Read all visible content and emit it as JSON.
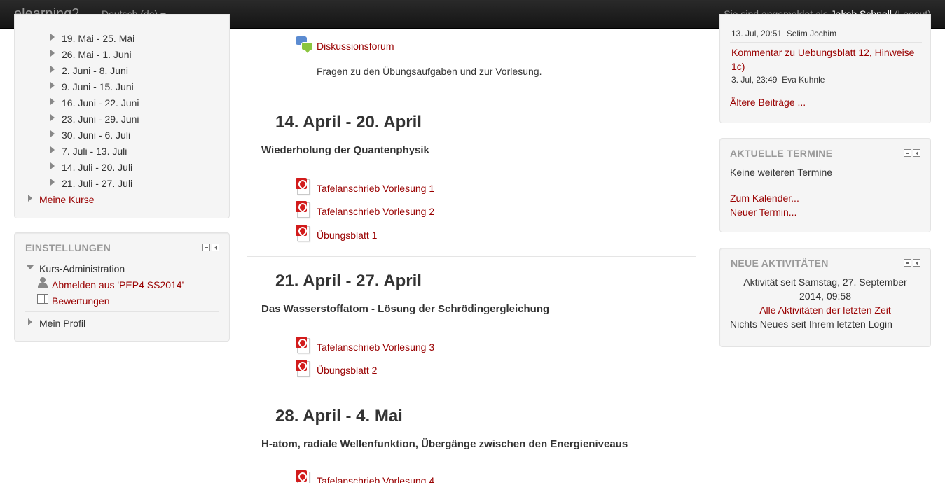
{
  "navbar": {
    "brand": "elearning2",
    "language": "Deutsch (de)",
    "login_prefix": "Sie sind angemeldet als ",
    "user_name": "Jakob Schnell",
    "logout": "(Logout)"
  },
  "navigation": {
    "weeks": [
      "19. Mai - 25. Mai",
      "26. Mai - 1. Juni",
      "2. Juni - 8. Juni",
      "9. Juni - 15. Juni",
      "16. Juni - 22. Juni",
      "23. Juni - 29. Juni",
      "30. Juni - 6. Juli",
      "7. Juli - 13. Juli",
      "14. Juli - 20. Juli",
      "21. Juli - 27. Juli"
    ],
    "my_courses": "Meine Kurse"
  },
  "settings": {
    "title": "EINSTELLUNGEN",
    "course_admin": "Kurs-Administration",
    "unenrol": "Abmelden aus 'PEP4 SS2014'",
    "grades": "Bewertungen",
    "my_profile": "Mein Profil"
  },
  "main": {
    "forum": {
      "label": "Diskussionsforum",
      "description": "Fragen zu den Übungsaufgaben und zur Vorlesung."
    },
    "sections": [
      {
        "title": "14. April - 20. April",
        "summary": "Wiederholung der Quantenphysik",
        "activities": [
          "Tafelanschrieb Vorlesung 1",
          "Tafelanschrieb Vorlesung 2",
          "Übungsblatt 1"
        ]
      },
      {
        "title": "21. April - 27. April",
        "summary": "Das Wasserstoffatom - Lösung der Schrödingergleichung",
        "activities": [
          "Tafelanschrieb Vorlesung 3",
          "Übungsblatt 2"
        ]
      },
      {
        "title": "28. April - 4. Mai",
        "summary": "H-atom, radiale Wellenfunktion, Übergänge zwischen den Energieniveaus",
        "activities": [
          "Tafelanschrieb Vorlesung 4"
        ]
      }
    ]
  },
  "news": {
    "post1_meta": "13. Jul, 20:51",
    "post1_author": "Selim Jochim",
    "post2_title": "Kommentar zu Uebungsblatt 12, Hinweise 1c)",
    "post2_meta": "3. Jul, 23:49",
    "post2_author": "Eva Kuhnle",
    "older": "Ältere Beiträge ..."
  },
  "upcoming": {
    "title": "AKTUELLE TERMINE",
    "none": "Keine weiteren Termine",
    "calendar": "Zum Kalender...",
    "new_event": "Neuer Termin..."
  },
  "recent": {
    "title": "NEUE AKTIVITÄTEN",
    "since_line1": "Aktivität seit Samstag, 27. September",
    "since_line2": "2014, 09:58",
    "all_link": "Alle Aktivitäten der letzten Zeit",
    "nothing_new": "Nichts Neues seit Ihrem letzten Login"
  },
  "colors": {
    "link": "#990000",
    "navbar": "#1b1b1b",
    "block_bg": "#f5f5f5",
    "pdf_red": "#d21b1b"
  }
}
